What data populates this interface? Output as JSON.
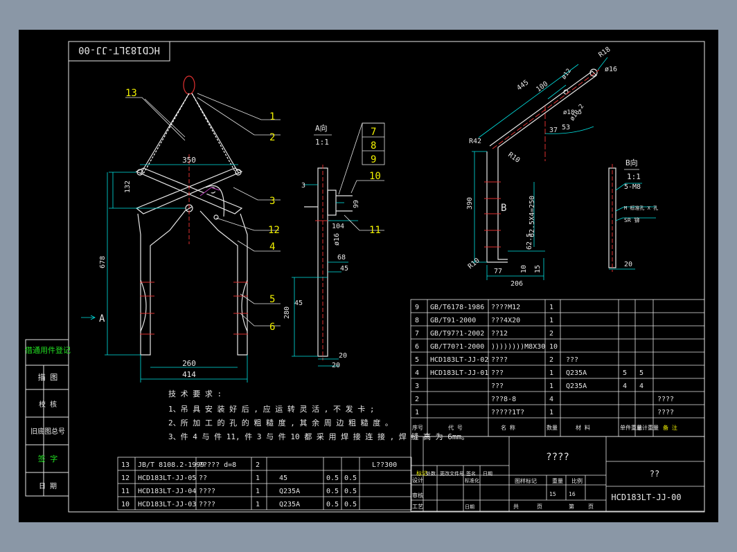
{
  "colors": {
    "background": "#8a97a6",
    "sheet": "#000000",
    "border": "#e8e8e8",
    "dim": "#00e5e5",
    "part": "#e8e8e8",
    "balloon": "#f2f200",
    "note": "#22e022",
    "center": "#e03030"
  },
  "drawing_no_mirrored": "HCD183LT-JJ-00",
  "main_view": {
    "balloons": [
      "1",
      "2",
      "3",
      "4",
      "5",
      "6",
      "12",
      "13"
    ],
    "dims": {
      "top_width": "350",
      "height_132": "132",
      "height_678": "678",
      "inner_260": "260",
      "outer_414": "414"
    },
    "view_arrow": "A"
  },
  "view_a": {
    "title": "A向",
    "scale": "1:1",
    "balloons": [
      "7",
      "8",
      "9",
      "10",
      "11"
    ],
    "dims": {
      "d3": "3",
      "d99": "99",
      "d104": "104",
      "d16": "ø16",
      "d68": "68",
      "d45a": "45",
      "d45b": "45",
      "d280": "280",
      "d20a": "20",
      "d20b": "20"
    }
  },
  "arm_view": {
    "dims": {
      "r18": "R18",
      "d16": "ø16",
      "l445": "445",
      "l100": "100",
      "d12": "ø12",
      "d1": "ø18.5",
      "d2": "ø18.2",
      "a37": "37",
      "a53": "53",
      "r42": "R42",
      "r10a": "R10",
      "r10b": "R10",
      "h390": "390",
      "pitch": "62.5X4=250",
      "p625": "62.5",
      "w77": "77",
      "w10": "10",
      "w15": "15",
      "w206": "206"
    },
    "section_b": "B"
  },
  "view_b": {
    "title": "B向",
    "scale": "1:1",
    "m8": "5-M8",
    "label2": "M 标准孔 X 孔",
    "label3": "SR 铆",
    "w20": "20"
  },
  "notes": {
    "title": "技 术 要 求 :",
    "lines": [
      "1、吊 具 安 装 好 后 , 应 运 转 灵 活 , 不 发 卡 ;",
      "2、所 加 工 的 孔 的 粗 糙 度 , 其 余 周 边 粗 糙 度 。",
      "3、件 4 与 件 11, 件 3 与 件 10 都 采 用 焊 接 连 接 , 焊 缝 高 为 6mm。"
    ]
  },
  "left_strip": [
    "借通用件登记",
    "描 图",
    "校 核",
    "旧底图总号",
    "签 字",
    "日 期"
  ],
  "bom_upper": [
    [
      "9",
      "GB/T6178-1986",
      "????M12",
      "1",
      "",
      "",
      "",
      ""
    ],
    [
      "8",
      "GB/T91-2000",
      "???4X20",
      "1",
      "",
      "",
      "",
      ""
    ],
    [
      "7",
      "GB/T97?1-2002",
      "??12",
      "2",
      "",
      "",
      "",
      ""
    ],
    [
      "6",
      "GB/T70?1-2000",
      "))))))))M8X30",
      "10",
      "",
      "",
      "",
      ""
    ],
    [
      "5",
      "HCD183LT-JJ-02",
      "????",
      "2",
      "???",
      "",
      "",
      ""
    ],
    [
      "4",
      "HCD183LT-JJ-01",
      "???",
      "1",
      "Q235A",
      "5",
      "5",
      ""
    ],
    [
      "3",
      "",
      "???",
      "1",
      "Q235A",
      "4",
      "4",
      ""
    ],
    [
      "2",
      "",
      "???8-8",
      "4",
      "",
      "",
      "",
      "????"
    ],
    [
      "1",
      "",
      "?????1T?",
      "1",
      "",
      "",
      "",
      "????"
    ]
  ],
  "bom_header": [
    "序号",
    "代 号",
    "名 称",
    "数量",
    "材 料",
    "单件重量",
    "总计重量",
    "备 注"
  ],
  "bom_lower": [
    [
      "13",
      "JB/T 8108.2-1999",
      "????? d=8",
      "2",
      "",
      "",
      "",
      "L??300"
    ],
    [
      "12",
      "HCD183LT-JJ-05",
      "??",
      "1",
      "45",
      "0.5",
      "0.5",
      ""
    ],
    [
      "11",
      "HCD183LT-JJ-04",
      "????",
      "1",
      "Q235A",
      "0.5",
      "0.5",
      ""
    ],
    [
      "10",
      "HCD183LT-JJ-03",
      "????",
      "1",
      "Q235A",
      "0.5",
      "0.5",
      ""
    ]
  ],
  "title_block": {
    "name": "????",
    "company": "??",
    "drawing_no": "HCD183LT-JJ-00",
    "labels": [
      "标记",
      "处数",
      "更改文件号",
      "签名",
      "日期",
      "设计",
      "标准化",
      "审核",
      "工艺",
      "日期",
      "图样标记",
      "重量",
      "比例",
      "共",
      "页",
      "第",
      "页"
    ],
    "sheet_total": "15",
    "sheet_no": "16"
  }
}
